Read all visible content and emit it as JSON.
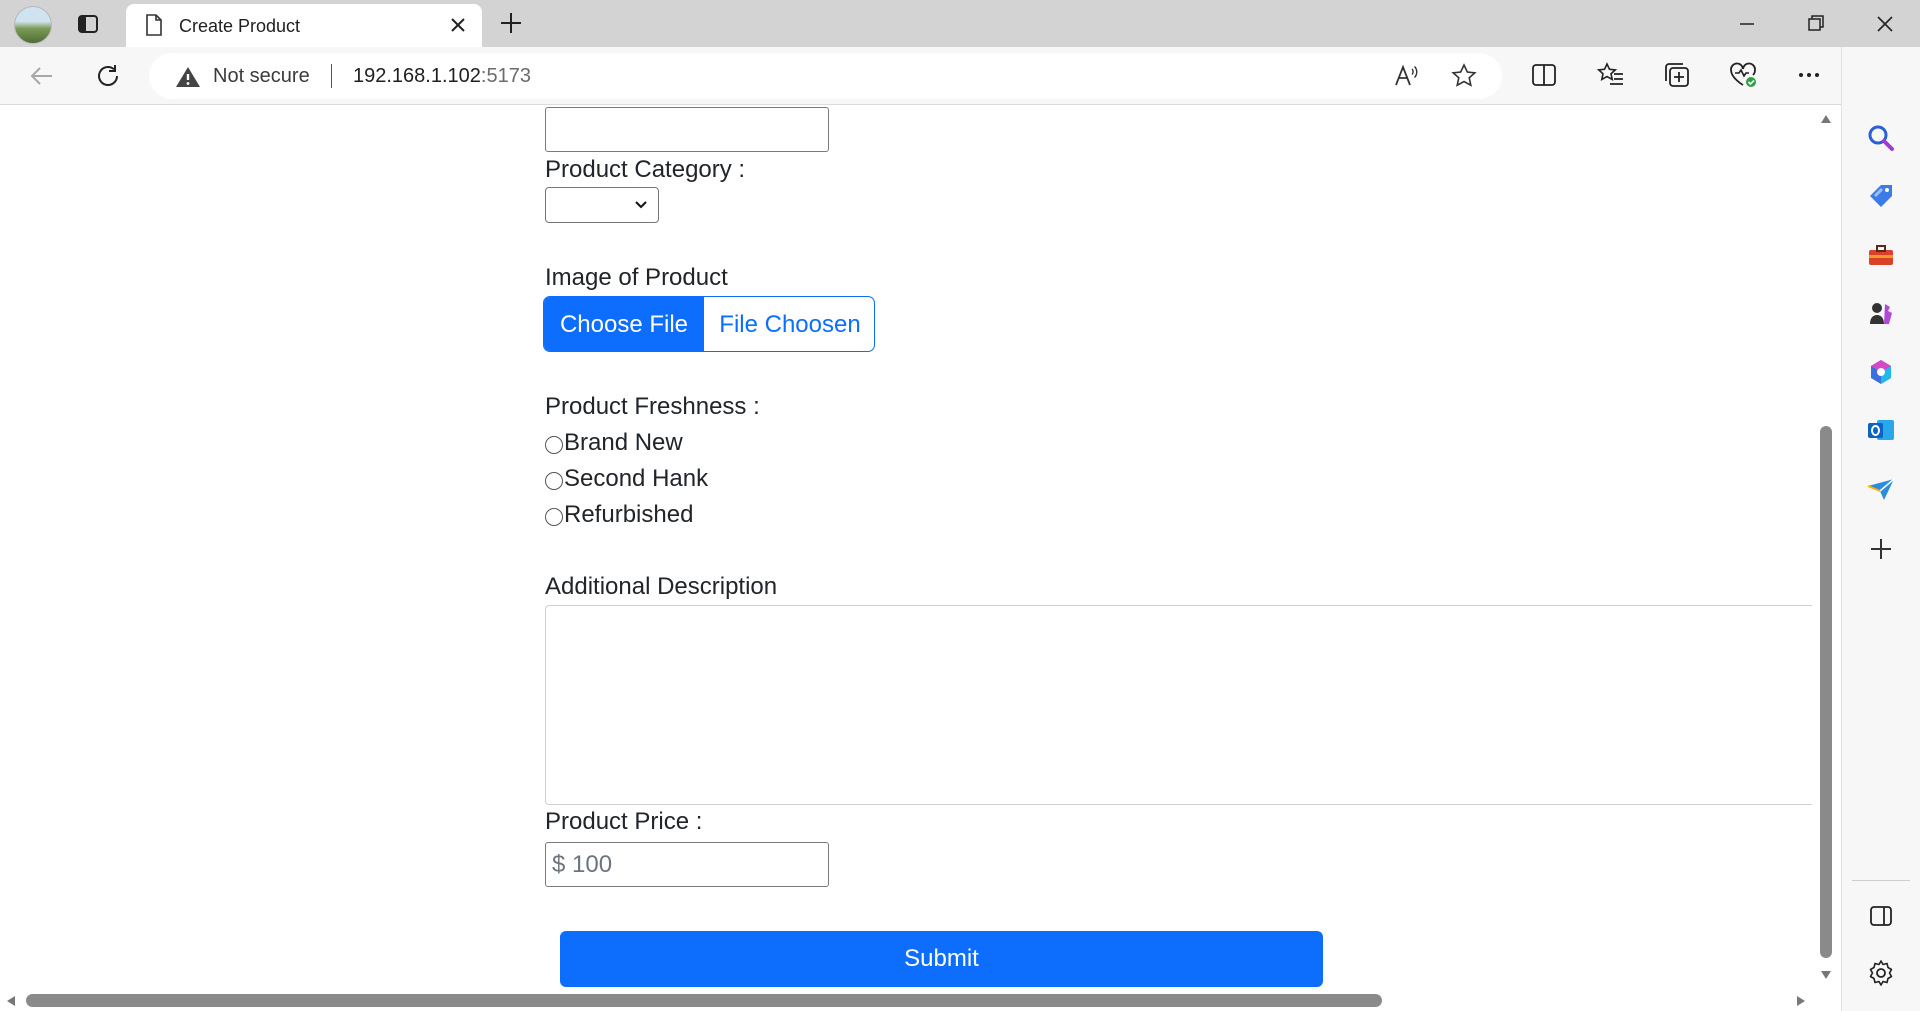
{
  "browser": {
    "tab_title": "Create Product",
    "security_label": "Not secure",
    "url_host": "192.168.1.102",
    "url_port": ":5173"
  },
  "form": {
    "category_label": "Product Category :",
    "image_label": "Image of Product",
    "choose_file_label": "Choose File",
    "file_status": "File Choosen",
    "freshness_label": "Product Freshness :",
    "freshness_options": [
      "Brand New",
      "Second Hank",
      "Refurbished"
    ],
    "description_label": "Additional Description",
    "price_label": "Product Price :",
    "price_value": "$ 100",
    "submit_label": "Submit"
  },
  "colors": {
    "primary": "#0d6efd",
    "tabstrip": "#d3d3d3",
    "toolbar": "#f7f7f7"
  }
}
